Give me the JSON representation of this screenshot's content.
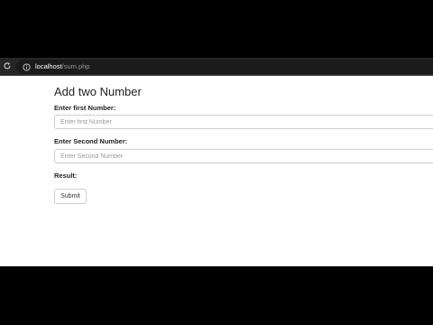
{
  "browser": {
    "url_host": "localhost",
    "url_path": "/sum.php"
  },
  "form": {
    "title": "Add two Number",
    "first_label": "Enter first Number:",
    "first_placeholder": "Enter first Number",
    "second_label": "Enter Second Number:",
    "second_placeholder": "Enter Second Number",
    "result_label": "Result:",
    "submit_label": "Submit"
  }
}
